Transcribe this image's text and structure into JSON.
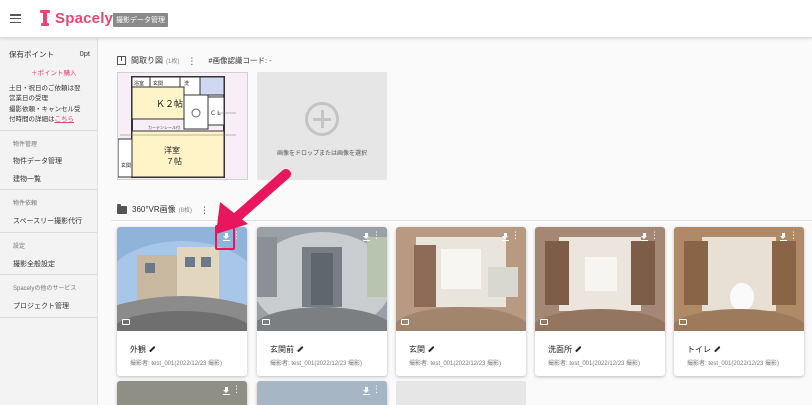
{
  "app": {
    "logo_text": "Spacely",
    "section_badge": "撮影データ管理"
  },
  "sidebar": {
    "points_label": "保有ポイント",
    "points_value": "0pt",
    "buy_points": "＋ポイント購入",
    "notice_lines": [
      "土日・祝日のご依頼は翌",
      "営業日の受理",
      "撮影依頼・キャンセル受",
      "付時間の詳細は"
    ],
    "notice_link": "こちら",
    "groups": [
      {
        "label": "物件管理",
        "items": [
          "物件データ管理",
          "建物一覧"
        ]
      },
      {
        "label": "物件依頼",
        "items": [
          "スペースリー撮影代行"
        ]
      },
      {
        "label": "設定",
        "items": [
          "撮影全般設定"
        ]
      },
      {
        "label": "Spacelyの他のサービス",
        "items": [
          "プロジェクト管理"
        ]
      }
    ]
  },
  "floorplan_section": {
    "title": "間取り図",
    "count": "(1枚)",
    "code_label": "#画像認識コード: -",
    "drop_text": "画像をドロップまたは画像を選択",
    "plan_labels": {
      "kitchen": "Ｋ２帖",
      "western": "洋室",
      "western_size": "７帖",
      "cl": "ＣＬ",
      "entrance": "玄関",
      "bath": "浴室",
      "wc": "洗",
      "curtain": "カーテンレール付",
      "balcony": "玄関"
    }
  },
  "vr_section": {
    "title": "360°VR画像",
    "count": "(8枚)",
    "cards": [
      {
        "title": "外観",
        "meta": "撮影者: test_001(2022/12/23 撮影)",
        "thumb": "exterior"
      },
      {
        "title": "玄関前",
        "meta": "撮影者: test_001(2022/12/23 撮影)",
        "thumb": "corridor"
      },
      {
        "title": "玄関",
        "meta": "撮影者: test_001(2022/12/23 撮影)",
        "thumb": "entrance"
      },
      {
        "title": "洗面所",
        "meta": "撮影者: test_001(2022/12/23 撮影)",
        "thumb": "washroom"
      },
      {
        "title": "トイレ",
        "meta": "撮影者: test_001(2022/12/23 撮影)",
        "thumb": "toilet"
      }
    ]
  },
  "colors": {
    "brand": "#e94473",
    "highlight": "#e8175d"
  },
  "icons": [
    "hamburger-icon",
    "floorplan-icon",
    "folder-icon",
    "download-icon",
    "kebab-icon",
    "comment-icon",
    "pencil-icon",
    "plus-circle-icon",
    "pointer-arrow"
  ]
}
